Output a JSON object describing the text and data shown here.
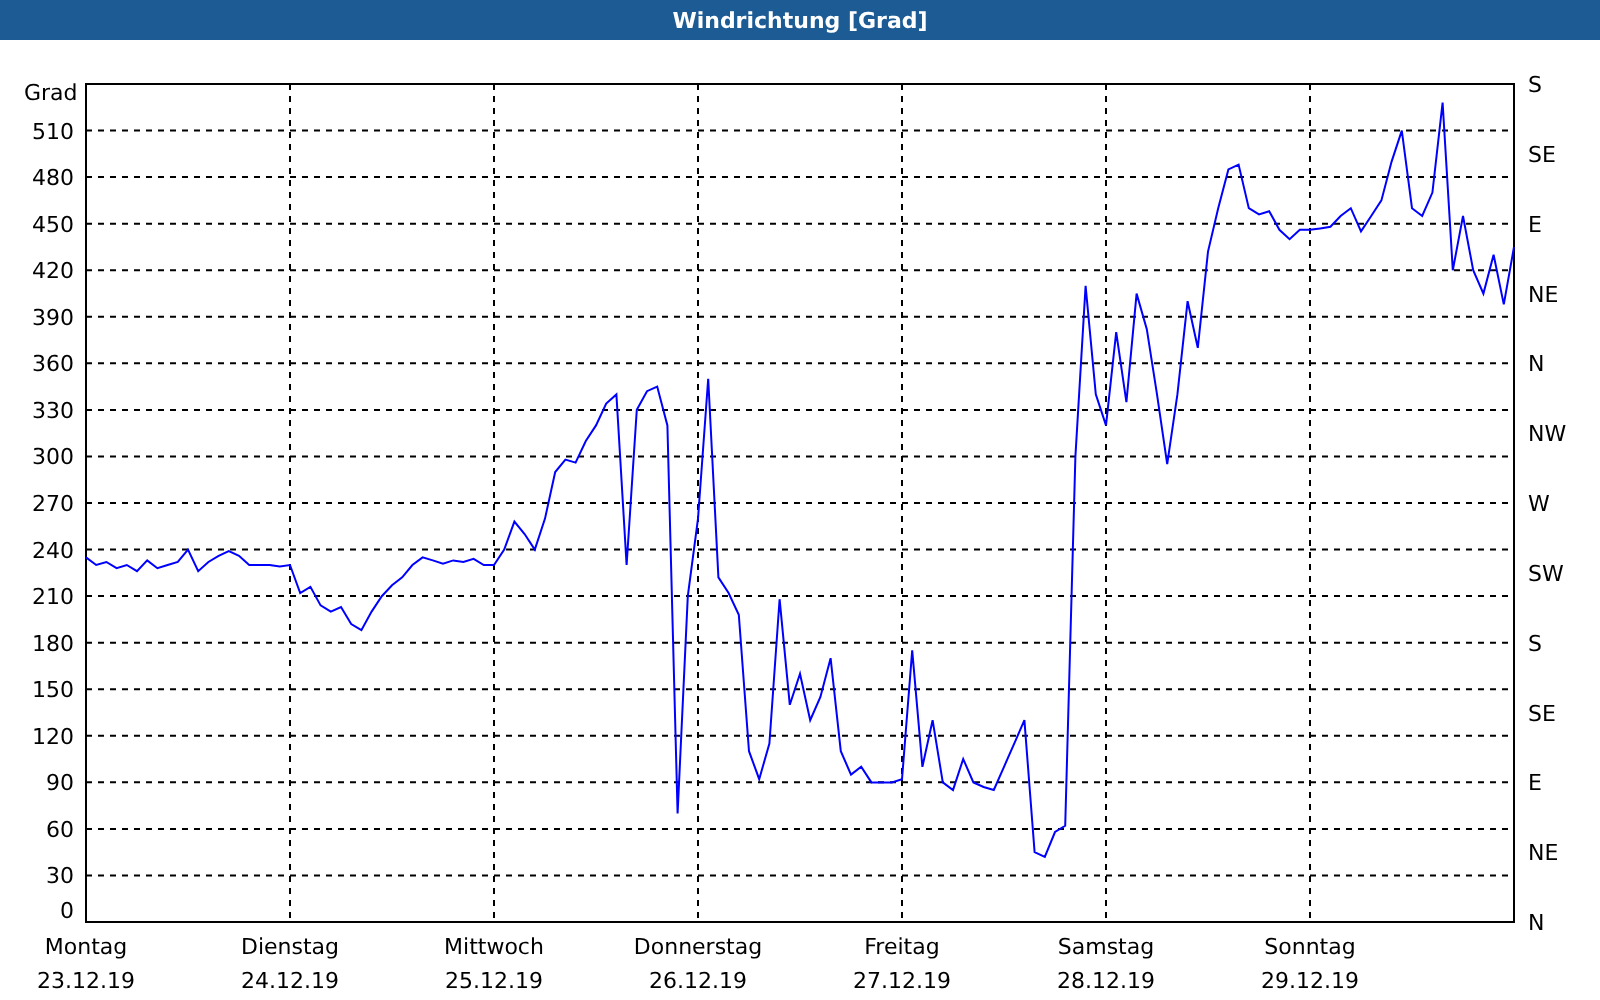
{
  "window": {
    "title": "Windrichtung [Grad]"
  },
  "chart": {
    "chart_data": {
      "type": "line",
      "grid": true,
      "ylabel": "Grad",
      "ylim": [
        0,
        540
      ],
      "yticks": [
        0,
        30,
        60,
        90,
        120,
        150,
        180,
        210,
        240,
        270,
        300,
        330,
        360,
        390,
        420,
        450,
        480,
        510
      ],
      "categories": [
        "Montag",
        null,
        null,
        null,
        null,
        null,
        null,
        null,
        null,
        null,
        null,
        null,
        null,
        null,
        null,
        null,
        null,
        null,
        null,
        null,
        "Dienstag",
        null,
        null,
        null,
        null,
        null,
        null,
        null,
        null,
        null,
        null,
        null,
        null,
        null,
        null,
        null,
        null,
        null,
        null,
        null,
        "Mittwoch",
        null,
        null,
        null,
        null,
        null,
        null,
        null,
        null,
        null,
        null,
        null,
        null,
        null,
        null,
        null,
        null,
        null,
        null,
        null,
        "Donnerstag",
        null,
        null,
        null,
        null,
        null,
        null,
        null,
        null,
        null,
        null,
        null,
        null,
        null,
        null,
        null,
        null,
        null,
        null,
        null,
        "Freitag",
        null,
        null,
        null,
        null,
        null,
        null,
        null,
        null,
        null,
        null,
        null,
        null,
        null,
        null,
        null,
        null,
        null,
        null,
        null,
        "Samstag",
        null,
        null,
        null,
        null,
        null,
        null,
        null,
        null,
        null,
        null,
        null,
        null,
        null,
        null,
        null,
        null,
        null,
        null,
        null,
        "Sonntag",
        null,
        null,
        null,
        null,
        null,
        null,
        null,
        null,
        null,
        null,
        null,
        null,
        null,
        null,
        null,
        null,
        null,
        null,
        null,
        null
      ],
      "series": [
        {
          "color": "#0000ff",
          "values": [
            235,
            230,
            232,
            228,
            230,
            226,
            233,
            228,
            230,
            232,
            240,
            226,
            232,
            236,
            239,
            236,
            230,
            230,
            230,
            229,
            230,
            212,
            216,
            204,
            200,
            203,
            192,
            188,
            200,
            210,
            217,
            222,
            230,
            235,
            233,
            231,
            233,
            232,
            234,
            230,
            230,
            240,
            258,
            250,
            240,
            260,
            290,
            298,
            296,
            310,
            320,
            334,
            340,
            230,
            330,
            342,
            345,
            320,
            70,
            210,
            260,
            350,
            222,
            212,
            198,
            110,
            92,
            115,
            208,
            140,
            160,
            130,
            145,
            170,
            110,
            95,
            100,
            90,
            90,
            90,
            92,
            175,
            100,
            130,
            90,
            85,
            105,
            90,
            87,
            85,
            100,
            115,
            130,
            45,
            42,
            58,
            62,
            300,
            410,
            340,
            320,
            380,
            335,
            405,
            382,
            340,
            295,
            340,
            400,
            370,
            432,
            460,
            485,
            488,
            460,
            456,
            458,
            446,
            440,
            446,
            446,
            447,
            448,
            455,
            460,
            445,
            455,
            465,
            490,
            510,
            460,
            455,
            470,
            528,
            420,
            455,
            420,
            405,
            430,
            398,
            435
          ]
        }
      ]
    },
    "date_labels": [
      "23.12.19",
      "24.12.19",
      "25.12.19",
      "26.12.19",
      "27.12.19",
      "28.12.19",
      "29.12.19"
    ],
    "right_labels": [
      "S",
      "SE",
      "E",
      "NE",
      "N",
      "NW",
      "W",
      "SW",
      "S",
      "SE",
      "E",
      "NE",
      "N"
    ]
  }
}
